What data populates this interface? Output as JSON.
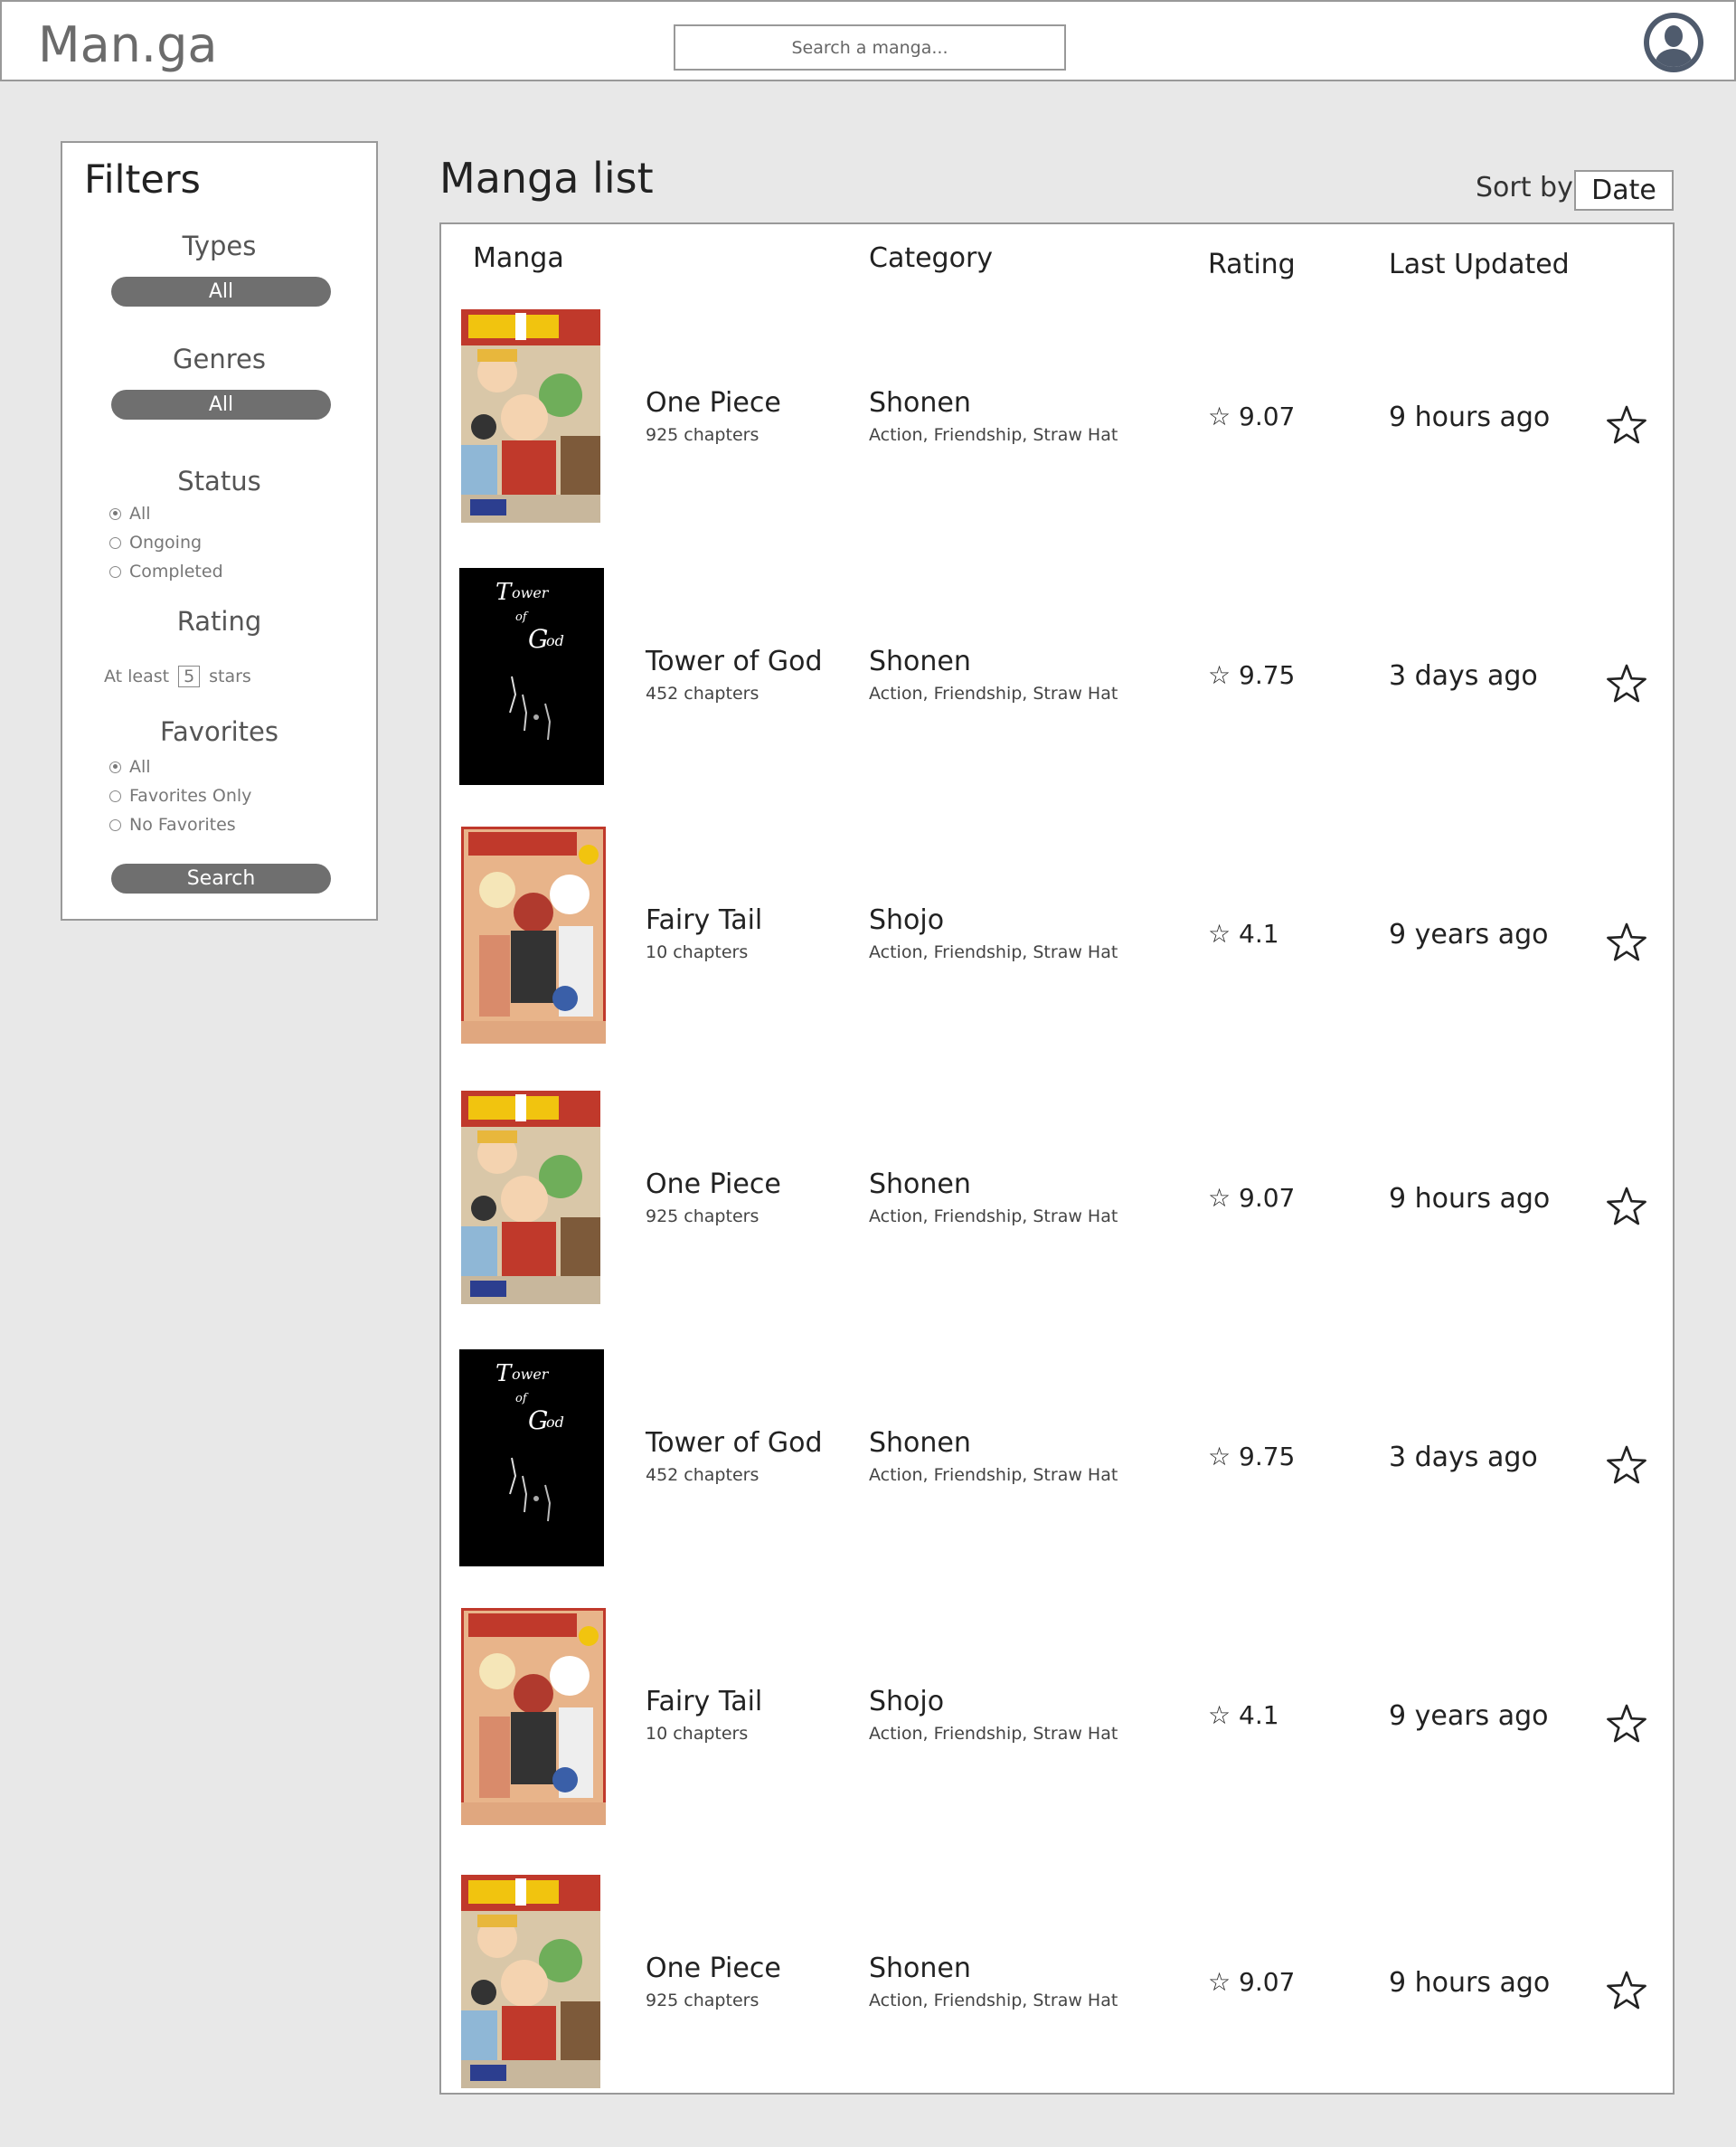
{
  "header": {
    "logo": "Man.ga",
    "search_placeholder": "Search a manga..."
  },
  "filters": {
    "title": "Filters",
    "types": {
      "title": "Types",
      "value": "All"
    },
    "genres": {
      "title": "Genres",
      "value": "All"
    },
    "status": {
      "title": "Status",
      "options": [
        "All",
        "Ongoing",
        "Completed"
      ],
      "selected": "All"
    },
    "rating": {
      "title": "Rating",
      "prefix": "At least",
      "value": "5",
      "suffix": "stars"
    },
    "favorites": {
      "title": "Favorites",
      "options": [
        "All",
        "Favorites Only",
        "No Favorites"
      ],
      "selected": "All"
    },
    "search_button": "Search"
  },
  "main": {
    "title": "Manga list",
    "sort_label": "Sort by",
    "sort_value": "Date",
    "columns": [
      "Manga",
      "Category",
      "Rating",
      "Last Updated"
    ],
    "rows": [
      {
        "title": "One Piece",
        "chapters": "925 chapters",
        "category": "Shonen",
        "tags": "Action, Friendship, Straw Hat",
        "rating": "☆ 9.07",
        "updated": "9 hours ago",
        "cover": "one-piece"
      },
      {
        "title": "Tower of God",
        "chapters": "452 chapters",
        "category": "Shonen",
        "tags": "Action, Friendship, Straw Hat",
        "rating": "☆ 9.75",
        "updated": "3 days ago",
        "cover": "tower-of-god"
      },
      {
        "title": "Fairy Tail",
        "chapters": "10 chapters",
        "category": "Shojo",
        "tags": "Action, Friendship, Straw Hat",
        "rating": "☆ 4.1",
        "updated": "9 years ago",
        "cover": "fairy-tail"
      },
      {
        "title": "One Piece",
        "chapters": "925 chapters",
        "category": "Shonen",
        "tags": "Action, Friendship, Straw Hat",
        "rating": "☆ 9.07",
        "updated": "9 hours ago",
        "cover": "one-piece"
      },
      {
        "title": "Tower of God",
        "chapters": "452 chapters",
        "category": "Shonen",
        "tags": "Action, Friendship, Straw Hat",
        "rating": "☆ 9.75",
        "updated": "3 days ago",
        "cover": "tower-of-god"
      },
      {
        "title": "Fairy Tail",
        "chapters": "10 chapters",
        "category": "Shojo",
        "tags": "Action, Friendship, Straw Hat",
        "rating": "☆ 4.1",
        "updated": "9 years ago",
        "cover": "fairy-tail"
      },
      {
        "title": "One Piece",
        "chapters": "925 chapters",
        "category": "Shonen",
        "tags": "Action, Friendship, Straw Hat",
        "rating": "☆ 9.07",
        "updated": "9 hours ago",
        "cover": "one-piece"
      }
    ]
  },
  "colors": {
    "background": "#e8e8e8",
    "panel": "#ffffff",
    "border": "#999999",
    "pill": "#6f6f6f",
    "avatar": "#4f5b6d"
  }
}
